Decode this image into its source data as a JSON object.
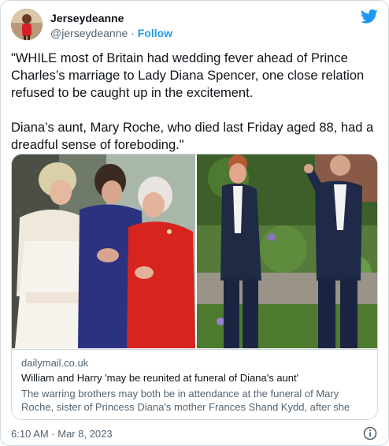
{
  "tweet": {
    "author": {
      "display_name": "Jerseydeanne",
      "handle": "@jerseydeanne",
      "separator": " · ",
      "follow_label": "Follow"
    },
    "text": "\"WHILE most of Britain had wedding fever ahead of Prince Charles’s marriage to Lady Diana Spencer, one close relation refused to be caught up in the excitement.\n\nDiana’s aunt, Mary Roche, who died last Friday aged 88, had a dreadful sense of foreboding.\"",
    "timestamp": "6:10 AM · Mar 8, 2023"
  },
  "link_card": {
    "domain": "dailymail.co.uk",
    "title": "William and Harry 'may be reunited at funeral of Diana's aunt'",
    "description": "The warring brothers may both be in attendance at the funeral of Mary Roche, sister of Princess Diana's mother Frances Shand Kydd, after she died last week,..."
  },
  "icons": {
    "brand": "twitter-bird-icon",
    "info": "info-icon"
  },
  "colors": {
    "accent": "#1d9bf0",
    "text": "#0f1419",
    "secondary_text": "#536471",
    "border": "#cfd9de"
  }
}
